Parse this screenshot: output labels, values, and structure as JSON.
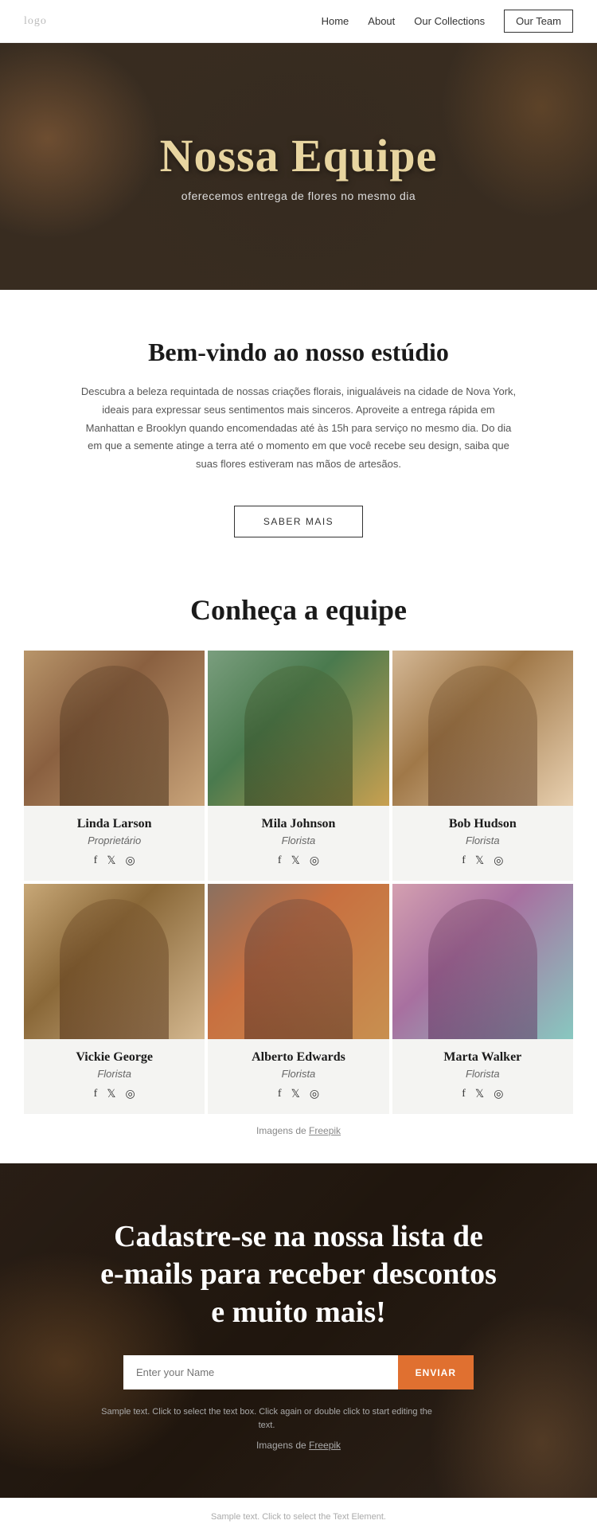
{
  "nav": {
    "logo": "logo",
    "links": [
      {
        "id": "home",
        "label": "Home",
        "bordered": false
      },
      {
        "id": "about",
        "label": "About",
        "bordered": false
      },
      {
        "id": "collections",
        "label": "Our Collections",
        "bordered": false
      },
      {
        "id": "team",
        "label": "Our Team",
        "bordered": true
      }
    ]
  },
  "hero": {
    "title": "Nossa Equipe",
    "subtitle": "oferecemos entrega de flores no mesmo dia"
  },
  "welcome": {
    "title": "Bem-vindo ao nosso estúdio",
    "text": "Descubra a beleza requintada de nossas criações florais, inigualáveis na cidade de Nova York, ideais para expressar seus sentimentos mais sinceros. Aproveite a entrega rápida em Manhattan e Brooklyn quando encomendadas até às 15h para serviço no mesmo dia. Do dia em que a semente atinge a terra até o momento em que você recebe seu design, saiba que suas flores estiveram nas mãos de artesãos.",
    "button_label": "SABER MAIS"
  },
  "team": {
    "section_title": "Conheça a equipe",
    "members": [
      {
        "id": "linda",
        "name": "Linda Larson",
        "role": "Proprietário",
        "photo_class": "photo-1",
        "fig_class": "fig-1"
      },
      {
        "id": "mila",
        "name": "Mila Johnson",
        "role": "Florista",
        "photo_class": "photo-2",
        "fig_class": "fig-2"
      },
      {
        "id": "bob",
        "name": "Bob Hudson",
        "role": "Florista",
        "photo_class": "photo-3",
        "fig_class": "fig-3"
      },
      {
        "id": "vickie",
        "name": "Vickie George",
        "role": "Florista",
        "photo_class": "photo-4",
        "fig_class": "fig-4"
      },
      {
        "id": "alberto",
        "name": "Alberto Edwards",
        "role": "Florista",
        "photo_class": "photo-5",
        "fig_class": "fig-5"
      },
      {
        "id": "marta",
        "name": "Marta Walker",
        "role": "Florista",
        "photo_class": "photo-6",
        "fig_class": "fig-6"
      }
    ],
    "freepik_text": "Imagens de ",
    "freepik_link": "Freepik"
  },
  "newsletter": {
    "title": "Cadastre-se na nossa lista de e-mails para receber descontos e muito mais!",
    "input_placeholder": "Enter your Name",
    "button_label": "ENVIAR",
    "sample_text": "Sample text. Click to select the text box. Click again or double click to start editing the text.",
    "freepik_text": "Imagens de ",
    "freepik_link": "Freepik"
  },
  "footer": {
    "sample_text": "Sample text. Click to select the Text Element."
  },
  "socials": {
    "facebook": "f",
    "twitter": "𝕏",
    "instagram": "⊙"
  }
}
